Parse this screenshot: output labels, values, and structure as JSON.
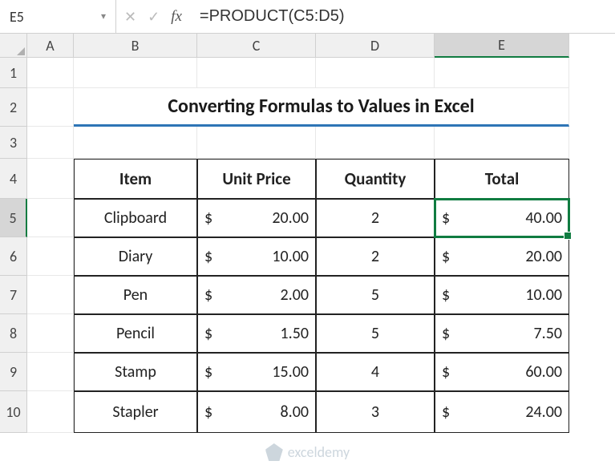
{
  "nameBox": "E5",
  "formula": "=PRODUCT(C5:D5)",
  "fxLabel": "fx",
  "columns": [
    "A",
    "B",
    "C",
    "D",
    "E"
  ],
  "rows": [
    "1",
    "2",
    "3",
    "4",
    "5",
    "6",
    "7",
    "8",
    "9",
    "10"
  ],
  "activeCol": "E",
  "activeRow": "5",
  "title": "Converting Formulas to Values in Excel",
  "headers": {
    "item": "Item",
    "price": "Unit Price",
    "qty": "Quantity",
    "total": "Total"
  },
  "currency": "$",
  "data": [
    {
      "item": "Clipboard",
      "price": "20.00",
      "qty": "2",
      "total": "40.00"
    },
    {
      "item": "Diary",
      "price": "10.00",
      "qty": "2",
      "total": "20.00"
    },
    {
      "item": "Pen",
      "price": "2.00",
      "qty": "5",
      "total": "10.00"
    },
    {
      "item": "Pencil",
      "price": "1.50",
      "qty": "5",
      "total": "7.50"
    },
    {
      "item": "Stamp",
      "price": "15.00",
      "qty": "4",
      "total": "60.00"
    },
    {
      "item": "Stapler",
      "price": "8.00",
      "qty": "3",
      "total": "24.00"
    }
  ],
  "watermark": "exceldemy",
  "chart_data": {
    "type": "table",
    "title": "Converting Formulas to Values in Excel",
    "columns": [
      "Item",
      "Unit Price",
      "Quantity",
      "Total"
    ],
    "rows": [
      [
        "Clipboard",
        20.0,
        2,
        40.0
      ],
      [
        "Diary",
        10.0,
        2,
        20.0
      ],
      [
        "Pen",
        2.0,
        5,
        10.0
      ],
      [
        "Pencil",
        1.5,
        5,
        7.5
      ],
      [
        "Stamp",
        15.0,
        4,
        60.0
      ],
      [
        "Stapler",
        8.0,
        3,
        24.0
      ]
    ]
  }
}
